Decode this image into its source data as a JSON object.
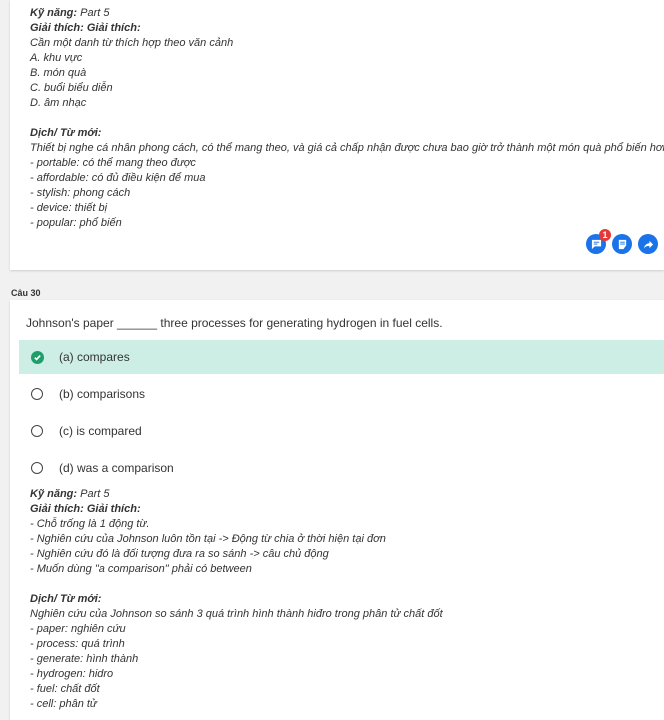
{
  "top_card": {
    "lines": [
      {
        "text": "Kỹ năng: Part 5",
        "bold_prefix": "Kỹ năng:"
      },
      {
        "text": "Giải thích: Giải thích:",
        "bold": true
      },
      {
        "text": "Cần một danh từ thích hợp theo văn cảnh"
      },
      {
        "text": "A. khu vực"
      },
      {
        "text": "B. món quà"
      },
      {
        "text": "C. buổi biểu diễn"
      },
      {
        "text": "D. âm nhạc"
      },
      {
        "text": ""
      },
      {
        "text": "Dịch/ Từ mới:",
        "bold": true
      },
      {
        "text": "Thiết bị nghe cá nhân phong cách, có thể mang theo, và giá cả chấp nhận được chưa bao giờ trở thành một món quà phổ biến hơn"
      },
      {
        "text": "- portable: có thể mang theo được"
      },
      {
        "text": "- affordable: có đủ điều kiện để mua"
      },
      {
        "text": "- stylish: phong cách"
      },
      {
        "text": "- device: thiết bị"
      },
      {
        "text": "- popular: phổ biến"
      }
    ],
    "actions": [
      {
        "icon": "comment-icon",
        "badge": "1"
      },
      {
        "icon": "note-icon"
      },
      {
        "icon": "share-arrow-icon"
      }
    ],
    "accent_color": "#1a73e8"
  },
  "question": {
    "label": "Câu 30",
    "text": "Johnson's paper ______ three processes for generating hydrogen in fuel cells.",
    "options": [
      {
        "label": "(a) compares",
        "selected": true
      },
      {
        "label": "(b) comparisons",
        "selected": false
      },
      {
        "label": "(c) is compared",
        "selected": false
      },
      {
        "label": "(d) was a comparison",
        "selected": false
      }
    ],
    "selected_color": "#cdeee5",
    "check_color": "#1e9e6a",
    "explanation": [
      {
        "text": "Kỹ năng: Part 5",
        "bold_prefix": "Kỹ năng:"
      },
      {
        "text": "Giải thích: Giải thích:",
        "bold": true
      },
      {
        "text": "- Chỗ trống là 1 động từ."
      },
      {
        "text": "- Nghiên cứu của Johnson luôn tồn tại -> Động từ chia ở thời hiện tại đơn"
      },
      {
        "text": "- Nghiên cứu đó là đối tượng đưa ra so sánh -> câu chủ động"
      },
      {
        "text": "- Muốn dùng \"a comparison\" phải có between"
      },
      {
        "text": ""
      },
      {
        "text": "Dịch/ Từ mới:",
        "bold": true
      },
      {
        "text": "Nghiên cứu của Johnson so sánh 3 quá trình hình thành hiđro trong phân tử chất đốt"
      },
      {
        "text": "- paper: nghiên cứu"
      },
      {
        "text": "- process: quá trình"
      },
      {
        "text": "- generate: hình thành"
      },
      {
        "text": "- hydrogen: hidro"
      },
      {
        "text": "- fuel: chất đốt"
      },
      {
        "text": "- cell: phân tử"
      }
    ]
  }
}
